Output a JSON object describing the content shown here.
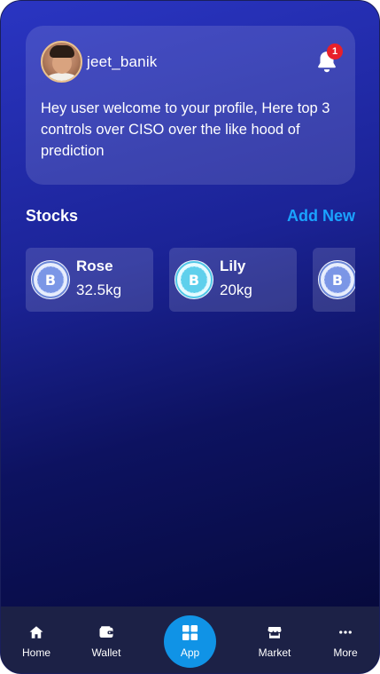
{
  "profile": {
    "username": "jeet_banik",
    "notification_count": "1",
    "welcome_text": "Hey user welcome to your profile, Here top 3 controls over CISO over the like hood of prediction"
  },
  "stocks": {
    "title": "Stocks",
    "add_new_label": "Add New",
    "items": [
      {
        "name": "Rose",
        "weight": "32.5kg",
        "icon": "bitcoin-coin-icon"
      },
      {
        "name": "Lily",
        "weight": "20kg",
        "icon": "bitcoin-coin-icon"
      },
      {
        "name": "",
        "weight": "",
        "icon": "bitcoin-coin-icon"
      }
    ]
  },
  "nav": {
    "items": [
      {
        "label": "Home",
        "icon": "home-icon"
      },
      {
        "label": "Wallet",
        "icon": "wallet-icon"
      },
      {
        "label": "App",
        "icon": "grid-icon"
      },
      {
        "label": "Market",
        "icon": "store-icon"
      },
      {
        "label": "More",
        "icon": "more-icon"
      }
    ]
  },
  "colors": {
    "accent": "#1aa3ff",
    "app_button": "#1093e6",
    "badge": "#e8202a",
    "nav_background": "#1c2146"
  }
}
